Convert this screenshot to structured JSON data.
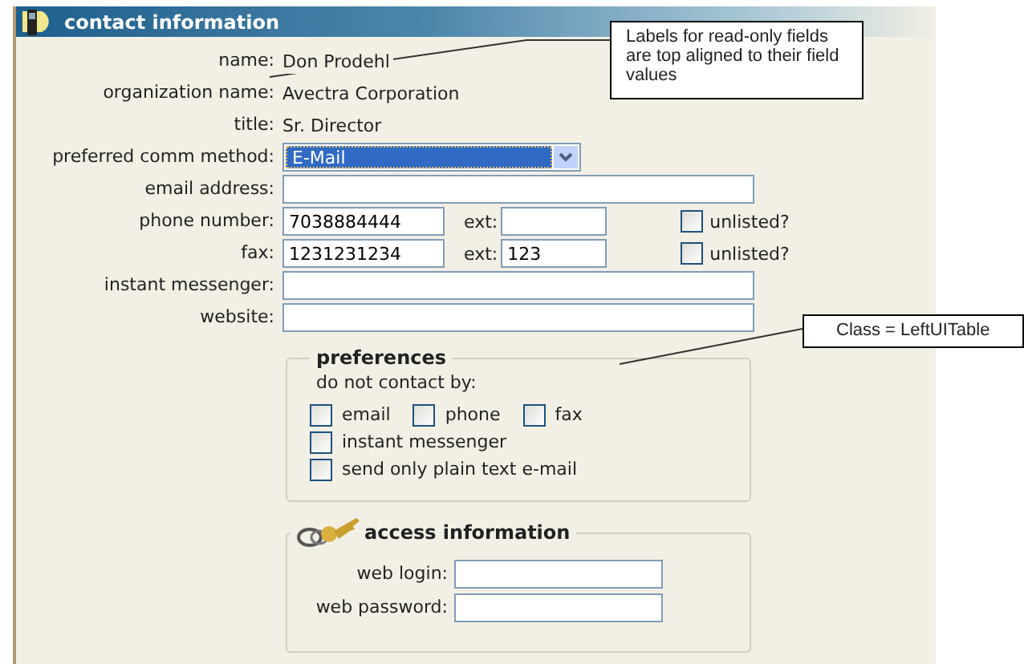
{
  "header": {
    "title": "contact information"
  },
  "fields": [
    {
      "kind": "readonly",
      "label": "name:",
      "value": "Don Prodehl"
    },
    {
      "kind": "readonly",
      "label": "organization name:",
      "value": "Avectra Corporation"
    },
    {
      "kind": "readonly",
      "label": "title:",
      "value": "Sr. Director"
    },
    {
      "kind": "select",
      "label": "preferred comm method:",
      "value": "E-Mail"
    },
    {
      "kind": "input",
      "label": "email address:"
    },
    {
      "kind": "phone",
      "label": "phone number:",
      "value": "7038884444",
      "ext_label": "ext:",
      "unlisted": {
        "label": "unlisted?",
        "checked": false
      }
    },
    {
      "kind": "phone",
      "label": "fax:",
      "value": "1231231234",
      "ext_label": "ext:",
      "ext": "123",
      "unlisted": {
        "label": "unlisted?",
        "checked": false
      }
    },
    {
      "kind": "input",
      "label": "instant messenger:"
    },
    {
      "kind": "input",
      "label": "website:"
    }
  ],
  "preferences": {
    "title": "preferences",
    "intro": "do not contact by:",
    "rows": [
      [
        {
          "label": "email",
          "checked": false
        },
        {
          "label": "phone",
          "checked": false
        },
        {
          "label": "fax",
          "checked": false
        }
      ],
      [
        {
          "label": "instant messenger",
          "checked": false
        }
      ],
      [
        {
          "label": "send only plain text e-mail",
          "checked": false
        }
      ]
    ]
  },
  "access": {
    "title": "access information",
    "fields": [
      {
        "label": "web login:"
      },
      {
        "label": "web password:"
      }
    ]
  },
  "annotations": [
    {
      "kind": "readonly-note",
      "text": "Labels for read-only fields are top aligned to their field values"
    },
    {
      "kind": "class-note",
      "text": "Class = LeftUITable"
    }
  ]
}
